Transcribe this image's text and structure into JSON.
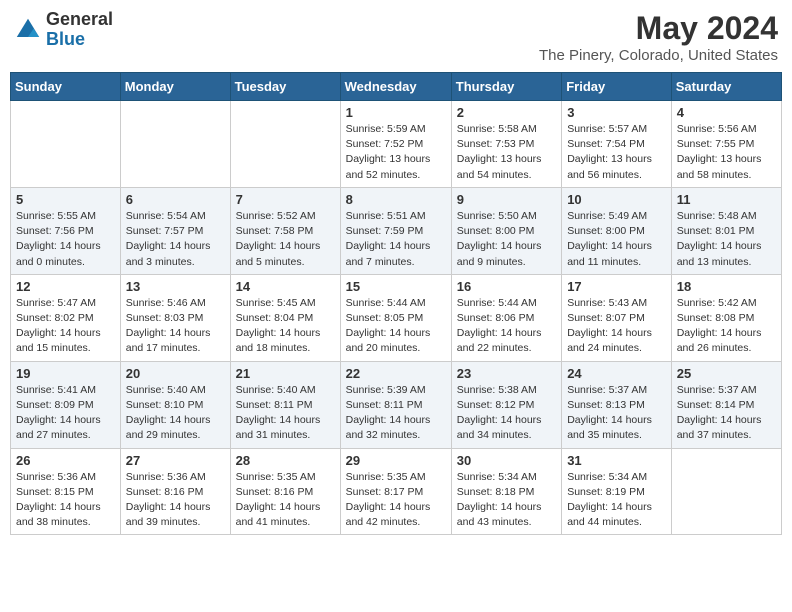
{
  "header": {
    "logo_general": "General",
    "logo_blue": "Blue",
    "month_title": "May 2024",
    "location": "The Pinery, Colorado, United States"
  },
  "weekdays": [
    "Sunday",
    "Monday",
    "Tuesday",
    "Wednesday",
    "Thursday",
    "Friday",
    "Saturday"
  ],
  "weeks": [
    [
      {
        "day": "",
        "info": ""
      },
      {
        "day": "",
        "info": ""
      },
      {
        "day": "",
        "info": ""
      },
      {
        "day": "1",
        "info": "Sunrise: 5:59 AM\nSunset: 7:52 PM\nDaylight: 13 hours\nand 52 minutes."
      },
      {
        "day": "2",
        "info": "Sunrise: 5:58 AM\nSunset: 7:53 PM\nDaylight: 13 hours\nand 54 minutes."
      },
      {
        "day": "3",
        "info": "Sunrise: 5:57 AM\nSunset: 7:54 PM\nDaylight: 13 hours\nand 56 minutes."
      },
      {
        "day": "4",
        "info": "Sunrise: 5:56 AM\nSunset: 7:55 PM\nDaylight: 13 hours\nand 58 minutes."
      }
    ],
    [
      {
        "day": "5",
        "info": "Sunrise: 5:55 AM\nSunset: 7:56 PM\nDaylight: 14 hours\nand 0 minutes."
      },
      {
        "day": "6",
        "info": "Sunrise: 5:54 AM\nSunset: 7:57 PM\nDaylight: 14 hours\nand 3 minutes."
      },
      {
        "day": "7",
        "info": "Sunrise: 5:52 AM\nSunset: 7:58 PM\nDaylight: 14 hours\nand 5 minutes."
      },
      {
        "day": "8",
        "info": "Sunrise: 5:51 AM\nSunset: 7:59 PM\nDaylight: 14 hours\nand 7 minutes."
      },
      {
        "day": "9",
        "info": "Sunrise: 5:50 AM\nSunset: 8:00 PM\nDaylight: 14 hours\nand 9 minutes."
      },
      {
        "day": "10",
        "info": "Sunrise: 5:49 AM\nSunset: 8:00 PM\nDaylight: 14 hours\nand 11 minutes."
      },
      {
        "day": "11",
        "info": "Sunrise: 5:48 AM\nSunset: 8:01 PM\nDaylight: 14 hours\nand 13 minutes."
      }
    ],
    [
      {
        "day": "12",
        "info": "Sunrise: 5:47 AM\nSunset: 8:02 PM\nDaylight: 14 hours\nand 15 minutes."
      },
      {
        "day": "13",
        "info": "Sunrise: 5:46 AM\nSunset: 8:03 PM\nDaylight: 14 hours\nand 17 minutes."
      },
      {
        "day": "14",
        "info": "Sunrise: 5:45 AM\nSunset: 8:04 PM\nDaylight: 14 hours\nand 18 minutes."
      },
      {
        "day": "15",
        "info": "Sunrise: 5:44 AM\nSunset: 8:05 PM\nDaylight: 14 hours\nand 20 minutes."
      },
      {
        "day": "16",
        "info": "Sunrise: 5:44 AM\nSunset: 8:06 PM\nDaylight: 14 hours\nand 22 minutes."
      },
      {
        "day": "17",
        "info": "Sunrise: 5:43 AM\nSunset: 8:07 PM\nDaylight: 14 hours\nand 24 minutes."
      },
      {
        "day": "18",
        "info": "Sunrise: 5:42 AM\nSunset: 8:08 PM\nDaylight: 14 hours\nand 26 minutes."
      }
    ],
    [
      {
        "day": "19",
        "info": "Sunrise: 5:41 AM\nSunset: 8:09 PM\nDaylight: 14 hours\nand 27 minutes."
      },
      {
        "day": "20",
        "info": "Sunrise: 5:40 AM\nSunset: 8:10 PM\nDaylight: 14 hours\nand 29 minutes."
      },
      {
        "day": "21",
        "info": "Sunrise: 5:40 AM\nSunset: 8:11 PM\nDaylight: 14 hours\nand 31 minutes."
      },
      {
        "day": "22",
        "info": "Sunrise: 5:39 AM\nSunset: 8:11 PM\nDaylight: 14 hours\nand 32 minutes."
      },
      {
        "day": "23",
        "info": "Sunrise: 5:38 AM\nSunset: 8:12 PM\nDaylight: 14 hours\nand 34 minutes."
      },
      {
        "day": "24",
        "info": "Sunrise: 5:37 AM\nSunset: 8:13 PM\nDaylight: 14 hours\nand 35 minutes."
      },
      {
        "day": "25",
        "info": "Sunrise: 5:37 AM\nSunset: 8:14 PM\nDaylight: 14 hours\nand 37 minutes."
      }
    ],
    [
      {
        "day": "26",
        "info": "Sunrise: 5:36 AM\nSunset: 8:15 PM\nDaylight: 14 hours\nand 38 minutes."
      },
      {
        "day": "27",
        "info": "Sunrise: 5:36 AM\nSunset: 8:16 PM\nDaylight: 14 hours\nand 39 minutes."
      },
      {
        "day": "28",
        "info": "Sunrise: 5:35 AM\nSunset: 8:16 PM\nDaylight: 14 hours\nand 41 minutes."
      },
      {
        "day": "29",
        "info": "Sunrise: 5:35 AM\nSunset: 8:17 PM\nDaylight: 14 hours\nand 42 minutes."
      },
      {
        "day": "30",
        "info": "Sunrise: 5:34 AM\nSunset: 8:18 PM\nDaylight: 14 hours\nand 43 minutes."
      },
      {
        "day": "31",
        "info": "Sunrise: 5:34 AM\nSunset: 8:19 PM\nDaylight: 14 hours\nand 44 minutes."
      },
      {
        "day": "",
        "info": ""
      }
    ]
  ]
}
